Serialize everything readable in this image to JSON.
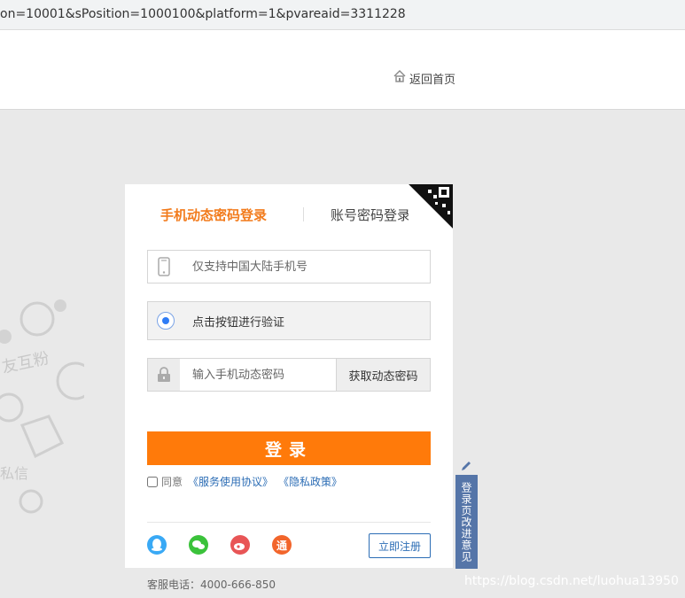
{
  "urlbar": {
    "text": "on=10001&sPosition=1000100&platform=1&pvareaid=3311228"
  },
  "header": {
    "home_label": "返回首页"
  },
  "login": {
    "tabs": {
      "active": "手机动态密码登录",
      "other": "账号密码登录"
    },
    "phone_placeholder": "仅支持中国大陆手机号",
    "verify_label": "点击按钮进行验证",
    "code_placeholder": "输入手机动态密码",
    "get_code_label": "获取动态密码",
    "login_button": "登录",
    "agree_prefix": "同意",
    "agree_terms": "《服务使用协议》",
    "agree_privacy": "《隐私政策》",
    "register_label": "立即注册",
    "social_tong_char": "通"
  },
  "service_phone": "客服电话：4000-666-850",
  "feedback_label": "登录页改进意见",
  "watermark": "https://blog.csdn.net/luohua13950",
  "decor": {
    "text_1": "友互粉",
    "text_2": "私信"
  },
  "colors": {
    "accent_orange": "#ff7a0a",
    "tab_active": "#f27b1c",
    "link_blue": "#2c6db5",
    "feedback_bg": "#5575a8",
    "page_bg": "#e9e9e9"
  },
  "icons": [
    "home-icon",
    "phone-icon",
    "lock-icon",
    "qr-code-icon",
    "qq-icon",
    "wechat-icon",
    "weibo-icon",
    "pencil-icon"
  ]
}
